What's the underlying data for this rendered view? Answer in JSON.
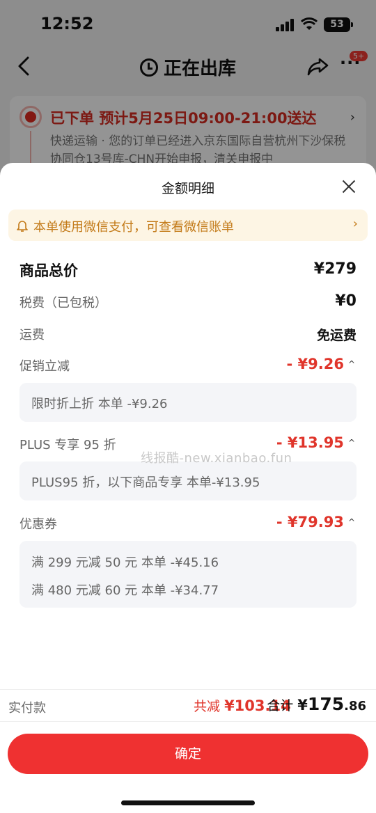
{
  "status_bar": {
    "time": "12:52",
    "battery": "53"
  },
  "navbar": {
    "title": "正在出库",
    "badge": "5+"
  },
  "order": {
    "status": "已下单",
    "eta": "预计5月25日09:00-21:00送达",
    "description": "快递运输 · 您的订单已经进入京东国际自营杭州下沙保税协同仓13号库-CHN开始申报，清关申报中"
  },
  "sheet": {
    "title": "金额明细",
    "notice": "本单使用微信支付，可查看微信账单",
    "rows": {
      "goods_total": {
        "label": "商品总价",
        "value": "¥279"
      },
      "tax": {
        "label": "税费（已包税）",
        "value": "¥0"
      },
      "shipping": {
        "label": "运费",
        "value": "免运费"
      },
      "promo": {
        "label": "促销立减",
        "value": "- ¥9.26"
      },
      "plus": {
        "label": "PLUS 专享 95 折",
        "value": "- ¥13.95"
      },
      "coupon": {
        "label": "优惠券",
        "value": "- ¥79.93"
      }
    },
    "details": {
      "promo": [
        "限时折上折    本单 -¥9.26"
      ],
      "plus": [
        "PLUS95 折，以下商品专享    本单-¥13.95"
      ],
      "coupon": [
        "满 299 元减 50 元    本单 -¥45.16",
        "满 480 元减 60 元    本单 -¥34.77"
      ]
    },
    "watermark": "线报酷-new.xianbao.fun"
  },
  "footer": {
    "pay_label": "实付款",
    "reduce_label": "共减",
    "reduce_value": "¥103.14",
    "total_label": "合计",
    "total_yen": "¥",
    "total_int": "175",
    "total_dec": ".86",
    "confirm": "确定"
  },
  "colors": {
    "accent_red": "#ef3131",
    "notice_bg": "#fdf5e4",
    "notice_text": "#c37a18"
  }
}
